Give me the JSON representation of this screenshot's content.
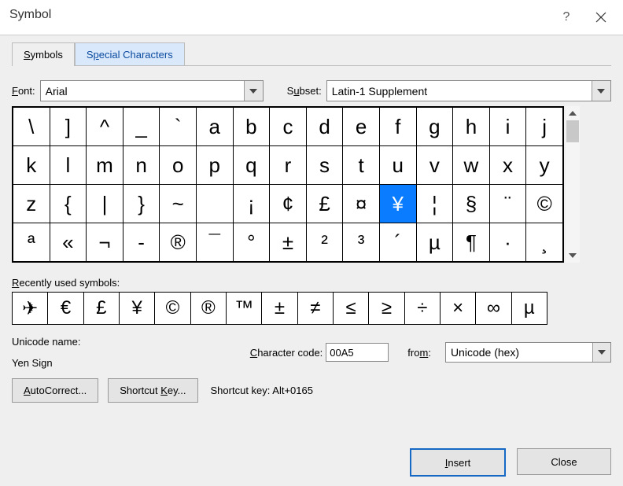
{
  "titlebar": {
    "title": "Symbol",
    "help": "?",
    "close": "✕"
  },
  "tabs": {
    "symbols": "Symbols",
    "special": "Special Characters"
  },
  "font_label": "Font:",
  "font_value": "Arial",
  "subset_label": "Subset:",
  "subset_value": "Latin-1 Supplement",
  "grid": {
    "rows": [
      {
        "cells": [
          "\\",
          "]",
          "^",
          "_",
          "`",
          "a",
          "b",
          "c",
          "d",
          "e",
          "f",
          "g",
          "h",
          "i",
          "j"
        ]
      },
      {
        "cells": [
          "k",
          "l",
          "m",
          "n",
          "o",
          "p",
          "q",
          "r",
          "s",
          "t",
          "u",
          "v",
          "w",
          "x",
          "y"
        ]
      },
      {
        "cells": [
          "z",
          "{",
          "|",
          "}",
          "~",
          " ",
          "¡",
          "¢",
          "£",
          "¤",
          "¥",
          "¦",
          "§",
          "¨",
          "©"
        ]
      },
      {
        "cells": [
          "ª",
          "«",
          "¬",
          "­-",
          "®",
          "¯",
          "°",
          "±",
          "²",
          "³",
          "´",
          "µ",
          "¶",
          "·",
          "¸"
        ]
      }
    ],
    "selected": {
      "row": 2,
      "col": 10
    }
  },
  "recent_label": "Recently used symbols:",
  "recent": [
    "✈",
    "€",
    "£",
    "¥",
    "©",
    "®",
    "™",
    "±",
    "≠",
    "≤",
    "≥",
    "÷",
    "×",
    "∞",
    "µ"
  ],
  "unicode_name_label": "Unicode name:",
  "unicode_name": "Yen Sign",
  "char_code_label": "Character code:",
  "char_code": "00A5",
  "from_label": "from:",
  "from_value": "Unicode (hex)",
  "autocorrect_btn": "AutoCorrect...",
  "shortcut_btn": "Shortcut Key...",
  "shortcut_info_label": "Shortcut key:",
  "shortcut_info_value": "Alt+0165",
  "insert_btn": "Insert",
  "close_btn": "Close"
}
